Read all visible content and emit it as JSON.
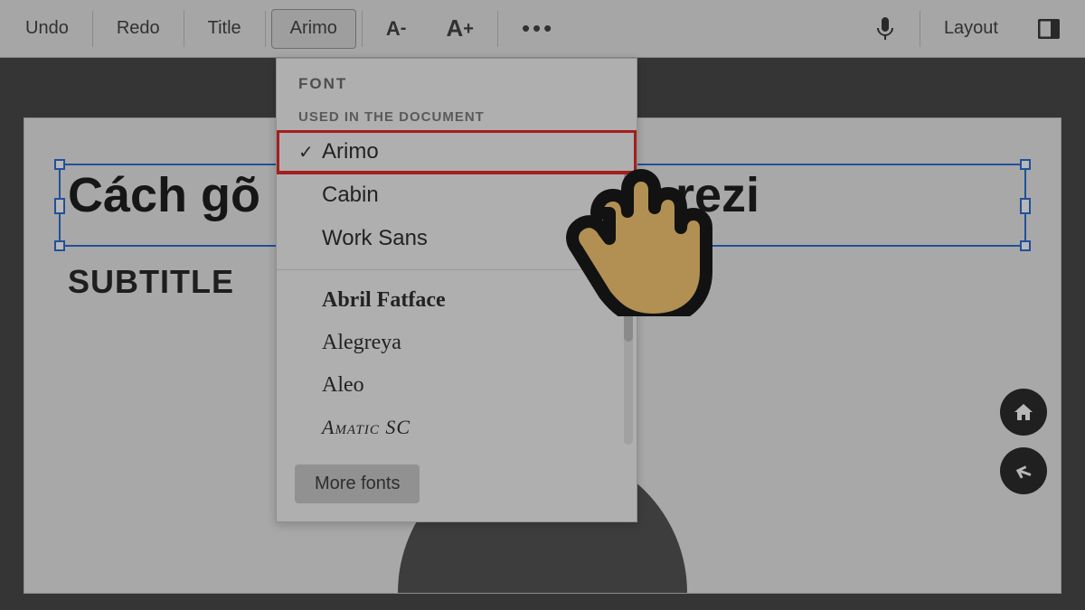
{
  "toolbar": {
    "undo": "Undo",
    "redo": "Redo",
    "title": "Title",
    "font_name": "Arimo",
    "dec_label": "A-",
    "inc_label": "A+",
    "more_label": "•••",
    "layout": "Layout"
  },
  "font_panel": {
    "header": "FONT",
    "section_used": "USED IN THE DOCUMENT",
    "used_fonts": [
      {
        "name": "Arimo",
        "selected": true
      },
      {
        "name": "Cabin",
        "selected": false
      },
      {
        "name": "Work Sans",
        "selected": false
      }
    ],
    "all_fonts": [
      {
        "name": "Abril Fatface"
      },
      {
        "name": "Alegreya"
      },
      {
        "name": "Aleo"
      },
      {
        "name": "Amatic SC"
      }
    ],
    "more_fonts": "More fonts"
  },
  "canvas": {
    "title_text": "Cách gõ",
    "title_suffix": "rezi",
    "subtitle": "SUBTITLE"
  },
  "icons": {
    "home": "home-icon",
    "back": "back-arrow-icon",
    "mic": "mic-icon",
    "panel": "panel-icon"
  }
}
